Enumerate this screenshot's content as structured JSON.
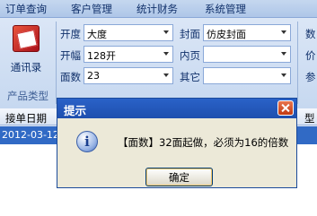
{
  "menu": [
    "订单查询",
    "客户管理",
    "统计财务",
    "系统管理"
  ],
  "ribbon": {
    "address_book_label": "通讯录",
    "group_label": "产品类型",
    "fields": {
      "kaidu": {
        "label": "开度",
        "value": "大度"
      },
      "kaifu": {
        "label": "开幅",
        "value": "128开"
      },
      "mianshu": {
        "label": "面数",
        "value": "23"
      },
      "fengmian": {
        "label": "封面",
        "value": "仿皮封面"
      },
      "neiye": {
        "label": "内页",
        "value": ""
      },
      "qita": {
        "label": "其它",
        "value": ""
      }
    },
    "partial_labels": [
      "数",
      "价",
      "参"
    ]
  },
  "grid": {
    "headers": [
      "接单日期",
      "型"
    ],
    "row_date": "2012-03-12"
  },
  "dialog": {
    "title": "提示",
    "message": "【面数】32面起做，必须为16的倍数",
    "ok_label": "确定"
  }
}
